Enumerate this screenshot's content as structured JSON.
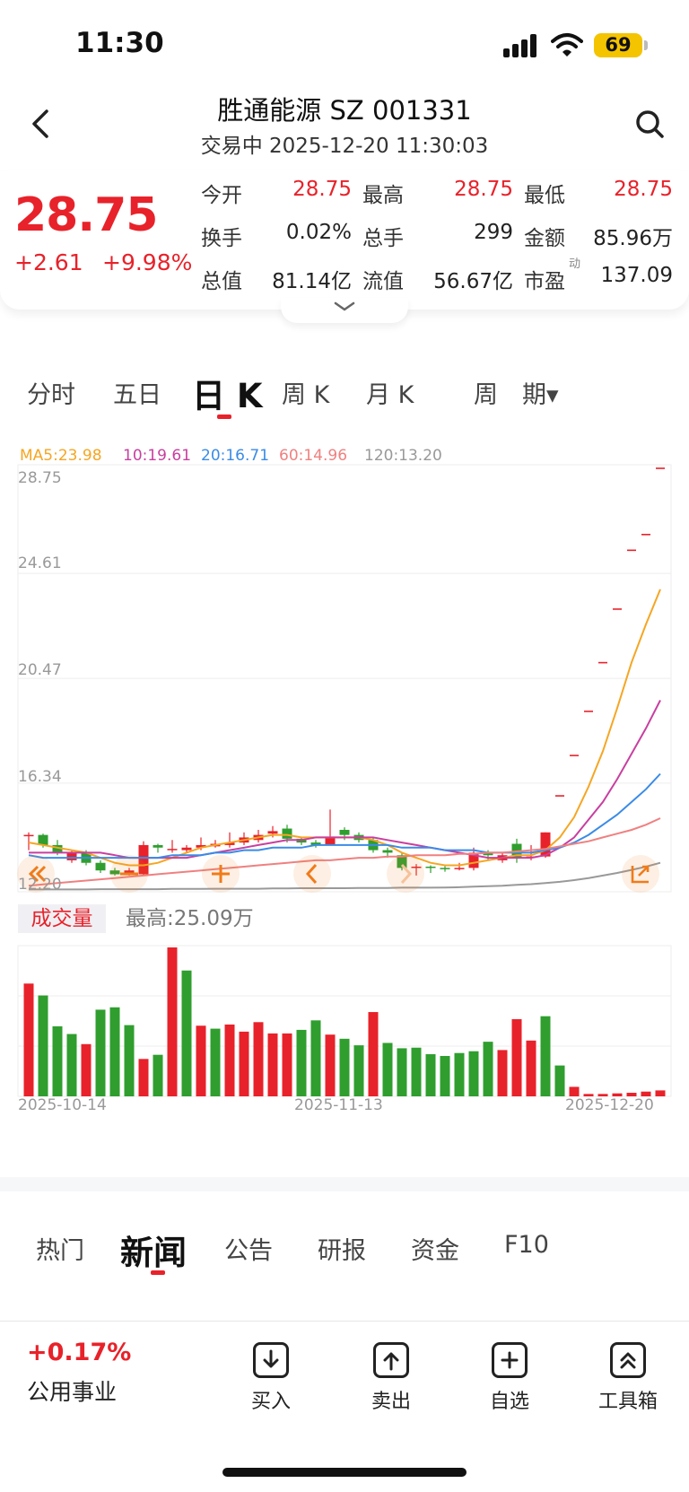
{
  "status_bar": {
    "time": "11:30",
    "battery": "69"
  },
  "header": {
    "title": "胜通能源 SZ 001331",
    "subtitle": "交易中 2025-12-20 11:30:03"
  },
  "quote": {
    "price": "28.75",
    "change": "+2.61",
    "change_pct": "+9.98%",
    "stats": [
      [
        {
          "label": "今开",
          "value": "28.75",
          "red": true
        },
        {
          "label": "最高",
          "value": "28.75",
          "red": true
        },
        {
          "label": "最低",
          "value": "28.75",
          "red": true
        }
      ],
      [
        {
          "label": "换手",
          "value": "0.02%",
          "red": false
        },
        {
          "label": "总手",
          "value": "299",
          "red": false
        },
        {
          "label": "金额",
          "value": "85.96万",
          "red": false
        }
      ],
      [
        {
          "label": "总值",
          "value": "81.14亿",
          "red": false
        },
        {
          "label": "流值",
          "value": "56.67亿",
          "red": false
        },
        {
          "label": "市盈",
          "value": "137.09",
          "red": false
        }
      ]
    ],
    "pe_badge": "动"
  },
  "period_tabs": [
    "分时",
    "五日",
    "日 K",
    "周 K",
    "月 K",
    "周　期▾"
  ],
  "active_period": "日 K",
  "ma_legend": [
    {
      "text": "MA5:23.98",
      "color": "#f5a623"
    },
    {
      "text": "10:19.61",
      "color": "#c83fa0"
    },
    {
      "text": "20:16.71",
      "color": "#3b8be6"
    },
    {
      "text": "60:14.96",
      "color": "#f08080"
    },
    {
      "text": "120:13.20",
      "color": "#999999"
    }
  ],
  "colors": {
    "up": "#e8222a",
    "down": "#2f9e2f",
    "accent_orange": "#f07b1a"
  },
  "chart_data": {
    "type": "candlestick",
    "y_ticks": [
      "28.75",
      "24.61",
      "20.47",
      "16.34",
      "12.20"
    ],
    "ylim": [
      12.2,
      28.75
    ],
    "dates": [
      "2025-10-14",
      "2025-11-13",
      "2025-12-20"
    ],
    "candles": [
      [
        14.25,
        14.3,
        14.4,
        13.7
      ],
      [
        14.3,
        13.9,
        14.35,
        13.8
      ],
      [
        13.9,
        13.6,
        14.1,
        13.5
      ],
      [
        13.3,
        13.6,
        13.7,
        13.2
      ],
      [
        13.6,
        13.2,
        13.7,
        13.1
      ],
      [
        13.2,
        12.9,
        13.3,
        12.8
      ],
      [
        12.9,
        12.75,
        13.0,
        12.7
      ],
      [
        12.75,
        12.9,
        13.0,
        12.7
      ],
      [
        12.75,
        13.9,
        14.05,
        12.7
      ],
      [
        13.9,
        13.8,
        13.95,
        13.6
      ],
      [
        13.7,
        13.75,
        14.1,
        13.6
      ],
      [
        13.7,
        13.8,
        13.9,
        13.6
      ],
      [
        13.8,
        13.9,
        14.2,
        13.7
      ],
      [
        13.85,
        13.95,
        14.1,
        13.8
      ],
      [
        13.9,
        14.0,
        14.4,
        13.8
      ],
      [
        14.0,
        14.2,
        14.4,
        13.9
      ],
      [
        14.1,
        14.3,
        14.5,
        14.0
      ],
      [
        14.35,
        14.45,
        14.65,
        14.2
      ],
      [
        14.55,
        14.15,
        14.7,
        14.0
      ],
      [
        14.15,
        14.0,
        14.2,
        13.9
      ],
      [
        14.0,
        13.9,
        14.1,
        13.8
      ],
      [
        13.9,
        14.2,
        15.3,
        13.9
      ],
      [
        14.5,
        14.3,
        14.6,
        14.1
      ],
      [
        14.3,
        14.1,
        14.4,
        14.0
      ],
      [
        14.1,
        13.7,
        14.2,
        13.6
      ],
      [
        13.7,
        13.6,
        13.8,
        13.4
      ],
      [
        13.5,
        13.0,
        13.6,
        12.9
      ],
      [
        13.0,
        13.05,
        13.15,
        12.7
      ],
      [
        13.05,
        13.0,
        13.1,
        12.8
      ],
      [
        13.0,
        12.95,
        13.1,
        12.85
      ],
      [
        12.95,
        13.0,
        13.2,
        12.9
      ],
      [
        13.0,
        13.6,
        13.8,
        12.9
      ],
      [
        13.6,
        13.5,
        13.7,
        13.3
      ],
      [
        13.3,
        13.5,
        13.6,
        13.2
      ],
      [
        13.95,
        13.4,
        14.15,
        13.2
      ],
      [
        13.4,
        13.45,
        13.9,
        13.3
      ],
      [
        13.45,
        14.4,
        14.4,
        13.4
      ],
      [
        15.84,
        15.84,
        15.84,
        15.84
      ],
      [
        17.43,
        17.43,
        17.43,
        17.43
      ],
      [
        19.17,
        19.17,
        19.17,
        19.17
      ],
      [
        21.09,
        21.09,
        21.09,
        21.09
      ],
      [
        23.2,
        23.2,
        23.2,
        23.2
      ],
      [
        25.52,
        25.52,
        25.52,
        25.52
      ],
      [
        26.14,
        26.14,
        26.14,
        26.14
      ],
      [
        28.75,
        28.75,
        28.75,
        28.75
      ]
    ],
    "ma": {
      "MA5": [
        14.0,
        13.9,
        13.8,
        13.7,
        13.6,
        13.4,
        13.2,
        13.1,
        13.1,
        13.2,
        13.4,
        13.6,
        13.8,
        13.9,
        14.0,
        14.1,
        14.2,
        14.3,
        14.3,
        14.2,
        14.2,
        14.2,
        14.2,
        14.2,
        14.1,
        13.9,
        13.6,
        13.4,
        13.2,
        13.1,
        13.1,
        13.2,
        13.3,
        13.4,
        13.5,
        13.5,
        13.7,
        14.2,
        15.0,
        16.2,
        17.6,
        19.3,
        21.1,
        22.6,
        23.98
      ],
      "MA10": [
        13.6,
        13.6,
        13.6,
        13.6,
        13.6,
        13.6,
        13.5,
        13.4,
        13.4,
        13.4,
        13.4,
        13.4,
        13.5,
        13.6,
        13.7,
        13.8,
        13.9,
        14.0,
        14.1,
        14.1,
        14.2,
        14.2,
        14.2,
        14.2,
        14.2,
        14.1,
        14.0,
        13.9,
        13.8,
        13.7,
        13.6,
        13.5,
        13.4,
        13.4,
        13.4,
        13.4,
        13.5,
        13.8,
        14.2,
        14.9,
        15.6,
        16.5,
        17.5,
        18.5,
        19.61
      ],
      "MA20": [
        13.5,
        13.4,
        13.4,
        13.4,
        13.4,
        13.4,
        13.4,
        13.4,
        13.4,
        13.4,
        13.5,
        13.5,
        13.5,
        13.6,
        13.6,
        13.7,
        13.7,
        13.8,
        13.8,
        13.8,
        13.9,
        13.9,
        13.9,
        13.9,
        13.9,
        13.9,
        13.8,
        13.8,
        13.8,
        13.7,
        13.7,
        13.7,
        13.6,
        13.6,
        13.6,
        13.6,
        13.7,
        13.8,
        14.0,
        14.3,
        14.7,
        15.1,
        15.6,
        16.1,
        16.71
      ],
      "MA60": [
        12.3,
        12.35,
        12.4,
        12.45,
        12.5,
        12.55,
        12.6,
        12.65,
        12.7,
        12.75,
        12.8,
        12.85,
        12.9,
        12.95,
        13.0,
        13.05,
        13.1,
        13.15,
        13.2,
        13.25,
        13.3,
        13.3,
        13.35,
        13.4,
        13.4,
        13.45,
        13.45,
        13.5,
        13.5,
        13.5,
        13.55,
        13.55,
        13.6,
        13.6,
        13.65,
        13.7,
        13.75,
        13.85,
        13.95,
        14.05,
        14.2,
        14.35,
        14.5,
        14.7,
        14.96
      ],
      "MA120": [
        12.15,
        12.15,
        12.15,
        12.15,
        12.15,
        12.16,
        12.16,
        12.16,
        12.16,
        12.16,
        12.17,
        12.17,
        12.17,
        12.18,
        12.18,
        12.18,
        12.18,
        12.19,
        12.19,
        12.2,
        12.2,
        12.2,
        12.2,
        12.21,
        12.21,
        12.21,
        12.22,
        12.22,
        12.22,
        12.23,
        12.24,
        12.26,
        12.28,
        12.3,
        12.33,
        12.36,
        12.4,
        12.45,
        12.52,
        12.6,
        12.7,
        12.8,
        12.92,
        13.05,
        13.2
      ]
    },
    "volume_label": "成交量",
    "volume_max_label": "最高:25.09万",
    "volumes": [
      19.0,
      17.0,
      11.8,
      10.5,
      8.8,
      14.6,
      15.0,
      12.0,
      6.3,
      7.0,
      25.09,
      21.2,
      11.9,
      11.4,
      12.1,
      10.9,
      12.5,
      10.6,
      10.6,
      11.2,
      12.8,
      10.4,
      9.7,
      8.6,
      14.2,
      9.0,
      8.1,
      8.2,
      7.1,
      6.8,
      7.3,
      7.6,
      9.2,
      7.8,
      13.0,
      9.4,
      13.5,
      5.2,
      1.6,
      0.4,
      0.4,
      0.5,
      0.6,
      0.8,
      1.0
    ],
    "volume_dir": [
      "up",
      "down",
      "down",
      "down",
      "up",
      "down",
      "down",
      "down",
      "up",
      "down",
      "up",
      "down",
      "up",
      "down",
      "up",
      "up",
      "up",
      "up",
      "up",
      "down",
      "down",
      "up",
      "down",
      "down",
      "up",
      "down",
      "down",
      "down",
      "down",
      "down",
      "down",
      "down",
      "down",
      "up",
      "up",
      "up",
      "down",
      "down",
      "up",
      "up",
      "up",
      "up",
      "up",
      "up",
      "up"
    ]
  },
  "news_tabs": [
    "热门",
    "新闻",
    "公告",
    "研报",
    "资金",
    "F10"
  ],
  "active_news_tab": "新闻",
  "sector": {
    "pct": "+0.17%",
    "name": "公用事业"
  },
  "actions": [
    {
      "label": "买入",
      "icon": "buy-icon"
    },
    {
      "label": "卖出",
      "icon": "sell-icon"
    },
    {
      "label": "自选",
      "icon": "watchlist-add-icon"
    },
    {
      "label": "工具箱",
      "icon": "toolbox-icon"
    }
  ]
}
